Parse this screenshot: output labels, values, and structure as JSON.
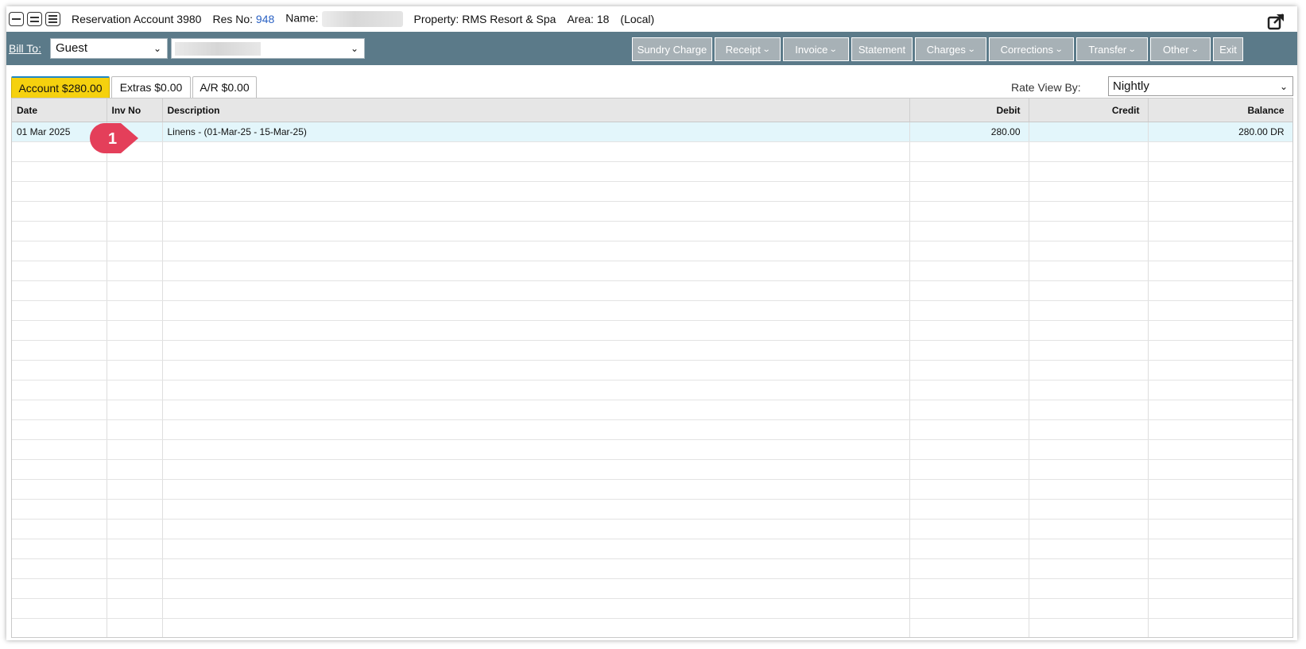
{
  "header": {
    "account_title": "Reservation Account 3980",
    "res_no_label": "Res No:",
    "res_no_value": "948",
    "name_label": "Name:",
    "property": "Property: RMS Resort & Spa",
    "area": "Area: 18",
    "local": "(Local)"
  },
  "toolbar": {
    "bill_to_label": "Bill To:",
    "bill_to_value": "Guest",
    "buttons": {
      "sundry_charge": "Sundry Charge",
      "receipt": "Receipt",
      "invoice": "Invoice",
      "statement": "Statement",
      "charges": "Charges",
      "corrections": "Corrections",
      "transfer": "Transfer",
      "other": "Other",
      "exit": "Exit"
    }
  },
  "tabs": {
    "account": "Account $280.00",
    "extras": "Extras $0.00",
    "ar": "A/R $0.00"
  },
  "rate_view": {
    "label": "Rate View By:",
    "value": "Nightly"
  },
  "table": {
    "headers": {
      "date": "Date",
      "inv_no": "Inv No",
      "description": "Description",
      "debit": "Debit",
      "credit": "Credit",
      "balance": "Balance"
    },
    "rows": [
      {
        "date": "01 Mar 2025",
        "inv_no": "",
        "description": "Linens - (01-Mar-25 - 15-Mar-25)",
        "debit": "280.00",
        "credit": "",
        "balance": "280.00 DR"
      }
    ]
  },
  "annotation": {
    "marker_number": "1"
  },
  "colors": {
    "toolbar_bg": "#5b7a89",
    "active_tab": "#f5d10e",
    "selected_row": "#e3f6fb",
    "marker": "#e43f5a",
    "res_no_link": "#2b62c4"
  }
}
